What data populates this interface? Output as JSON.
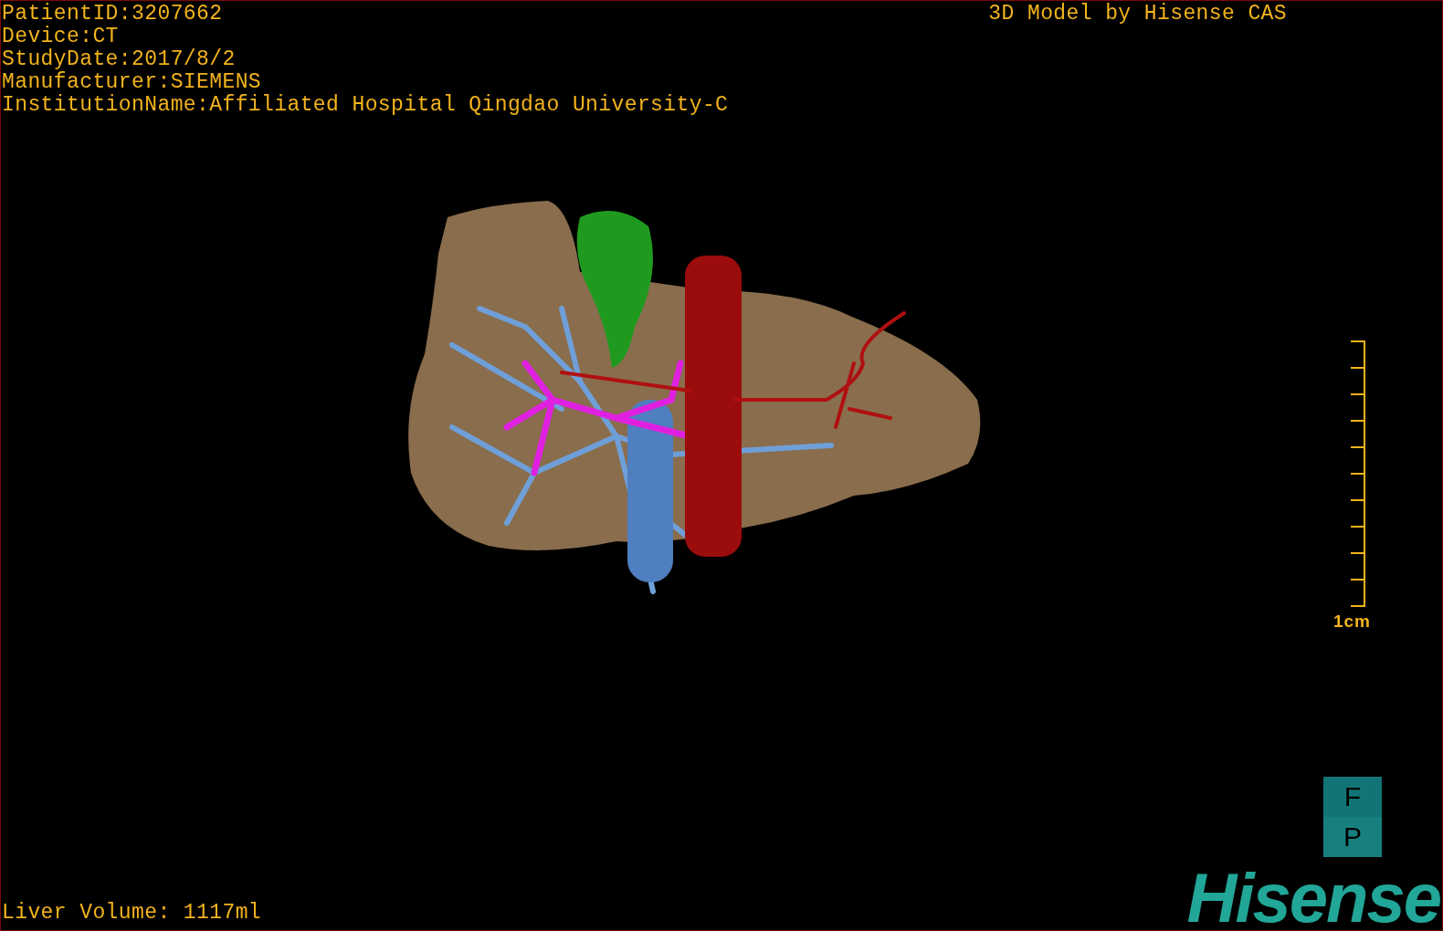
{
  "info_lines": [
    "PatientID:3207662",
    "Device:CT",
    "StudyDate:2017/8/2",
    "Manufacturer:SIEMENS",
    "InstitutionName:Affiliated Hospital Qingdao University-C"
  ],
  "title": "3D Model by Hisense CAS",
  "scale_bar": {
    "label": "1cm"
  },
  "orientation": [
    "F",
    "P"
  ],
  "liver_volume": "Liver Volume: 1117ml",
  "logo": "Hisense"
}
